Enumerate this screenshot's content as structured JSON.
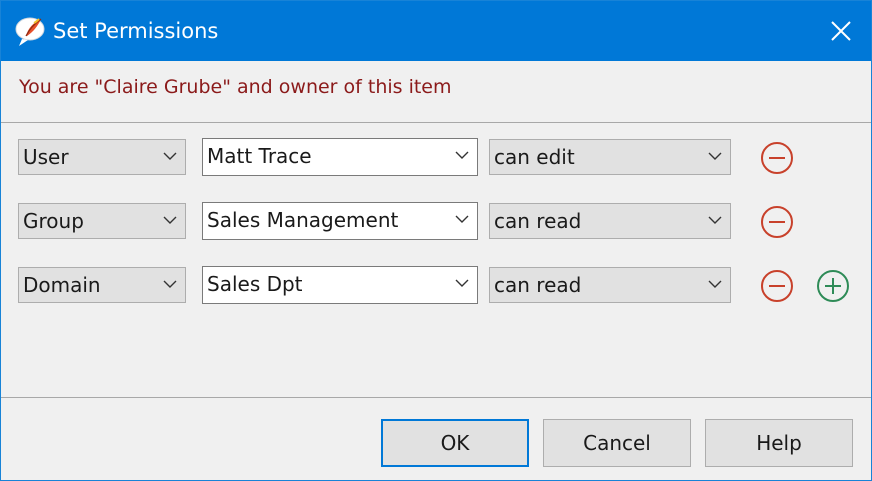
{
  "window": {
    "title": "Set Permissions"
  },
  "owner_message": "You are \"Claire Grube\" and owner of this item",
  "rows": [
    {
      "type": "User",
      "principal": "Matt Trace",
      "permission": "can edit"
    },
    {
      "type": "Group",
      "principal": "Sales Management",
      "permission": "can read"
    },
    {
      "type": "Domain",
      "principal": "Sales Dpt",
      "permission": "can read"
    }
  ],
  "buttons": {
    "ok": "OK",
    "cancel": "Cancel",
    "help": "Help"
  },
  "colors": {
    "titlebar": "#0078d7",
    "remove": "#c8412b",
    "add": "#2e8b57",
    "owner_text": "#8b1a1a"
  }
}
